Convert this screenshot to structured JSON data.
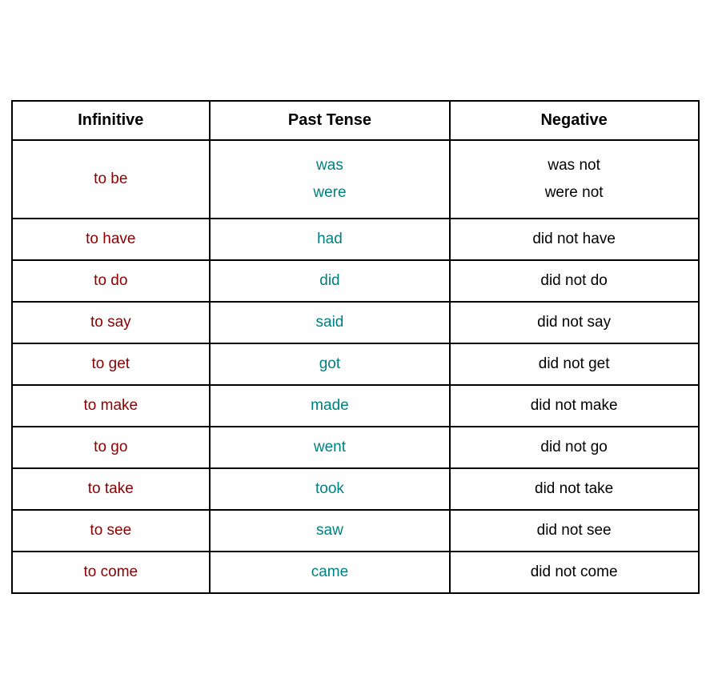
{
  "table": {
    "headers": [
      {
        "id": "infinitive",
        "label": "Infinitive"
      },
      {
        "id": "past-tense",
        "label": "Past Tense"
      },
      {
        "id": "negative",
        "label": "Negative"
      }
    ],
    "rows": [
      {
        "infinitive": "to be",
        "past_tense": "was\nwere",
        "negative": "was not\nwere not",
        "multiline": true
      },
      {
        "infinitive": "to have",
        "past_tense": "had",
        "negative": "did not have",
        "multiline": false
      },
      {
        "infinitive": "to do",
        "past_tense": "did",
        "negative": "did not do",
        "multiline": false
      },
      {
        "infinitive": "to say",
        "past_tense": "said",
        "negative": "did not say",
        "multiline": false
      },
      {
        "infinitive": "to get",
        "past_tense": "got",
        "negative": "did not get",
        "multiline": false
      },
      {
        "infinitive": "to make",
        "past_tense": "made",
        "negative": "did not make",
        "multiline": false
      },
      {
        "infinitive": "to go",
        "past_tense": "went",
        "negative": "did not go",
        "multiline": false
      },
      {
        "infinitive": "to take",
        "past_tense": "took",
        "negative": "did not take",
        "multiline": false
      },
      {
        "infinitive": "to see",
        "past_tense": "saw",
        "negative": "did not see",
        "multiline": false
      },
      {
        "infinitive": "to come",
        "past_tense": "came",
        "negative": "did not come",
        "multiline": false
      }
    ]
  }
}
